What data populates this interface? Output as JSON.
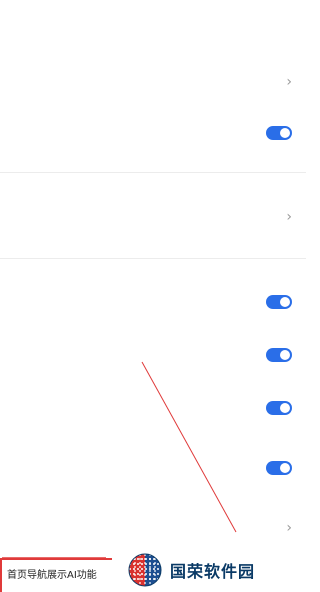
{
  "settings": {
    "rows": [
      {
        "label": "",
        "value": ""
      },
      {
        "label": ""
      },
      {
        "label": "",
        "toggle": "on"
      },
      {
        "label": "",
        "value": ""
      },
      {
        "label": "",
        "toggle": "on"
      },
      {
        "label": "",
        "toggle": "on"
      },
      {
        "label": "",
        "toggle": "on"
      },
      {
        "label": "",
        "subtitle": "",
        "toggle": "on"
      },
      {
        "label": "",
        "value": ""
      }
    ]
  },
  "highlight": {
    "label": "首页导航展示AI功能",
    "color": "#e03a3a"
  },
  "watermark": {
    "text": "国荣软件园"
  },
  "colors": {
    "toggle_on": "#2a6ee8",
    "annotation": "#e03a3a"
  }
}
